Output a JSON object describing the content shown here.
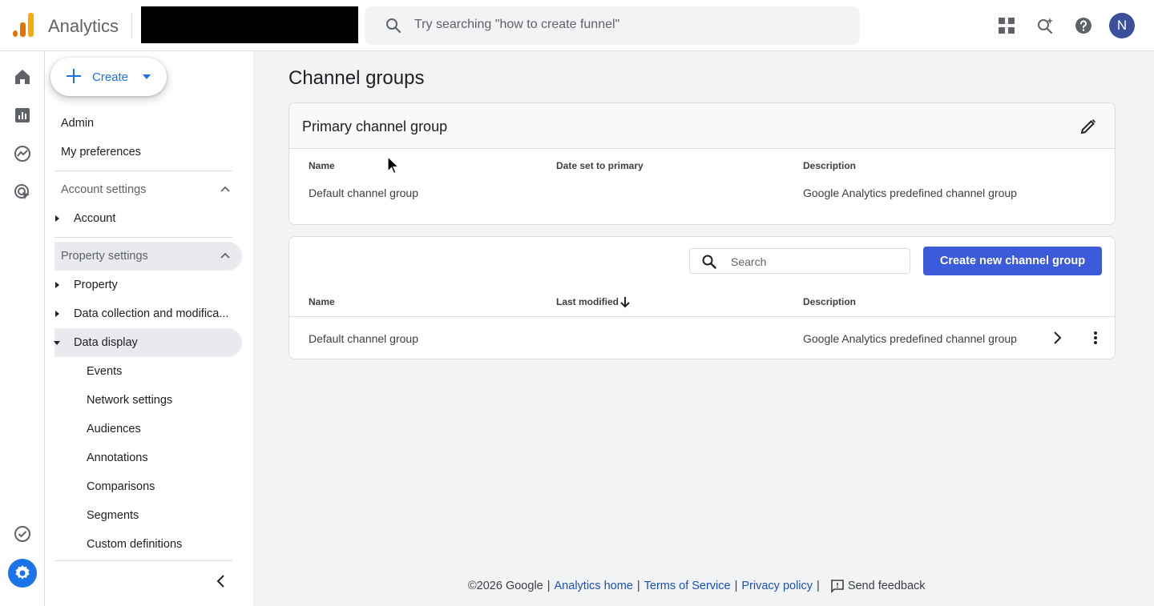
{
  "header": {
    "app_name": "Analytics",
    "search_placeholder": "Try searching \"how to create funnel\"",
    "avatar_initial": "N"
  },
  "nav": {
    "create_label": "Create",
    "admin": "Admin",
    "my_preferences": "My preferences",
    "account_settings": "Account settings",
    "account": "Account",
    "property_settings": "Property settings",
    "property": "Property",
    "data_collection": "Data collection and modifica...",
    "data_display": "Data display",
    "sub_items": [
      "Events",
      "Network settings",
      "Audiences",
      "Annotations",
      "Comparisons",
      "Segments",
      "Custom definitions"
    ]
  },
  "main": {
    "title": "Channel groups",
    "primary_card": {
      "title": "Primary channel group",
      "columns": [
        "Name",
        "Date set to primary",
        "Description"
      ],
      "row": {
        "name": "Default channel group",
        "date": "",
        "description": "Google Analytics predefined channel group"
      }
    },
    "groups_table": {
      "search_placeholder": "Search",
      "create_button": "Create new channel group",
      "columns": [
        "Name",
        "Last modified",
        "Description"
      ],
      "rows": [
        {
          "name": "Default channel group",
          "modified": "",
          "description": "Google Analytics predefined channel group"
        }
      ]
    }
  },
  "footer": {
    "copyright": "©2026 Google",
    "analytics_home": "Analytics home",
    "terms": "Terms of Service",
    "privacy": "Privacy policy",
    "send_feedback": "Send feedback",
    "separator": "|"
  },
  "colors": {
    "accent": "#1a73e8",
    "button": "#3b5bdb",
    "link": "#1a4fbf"
  }
}
